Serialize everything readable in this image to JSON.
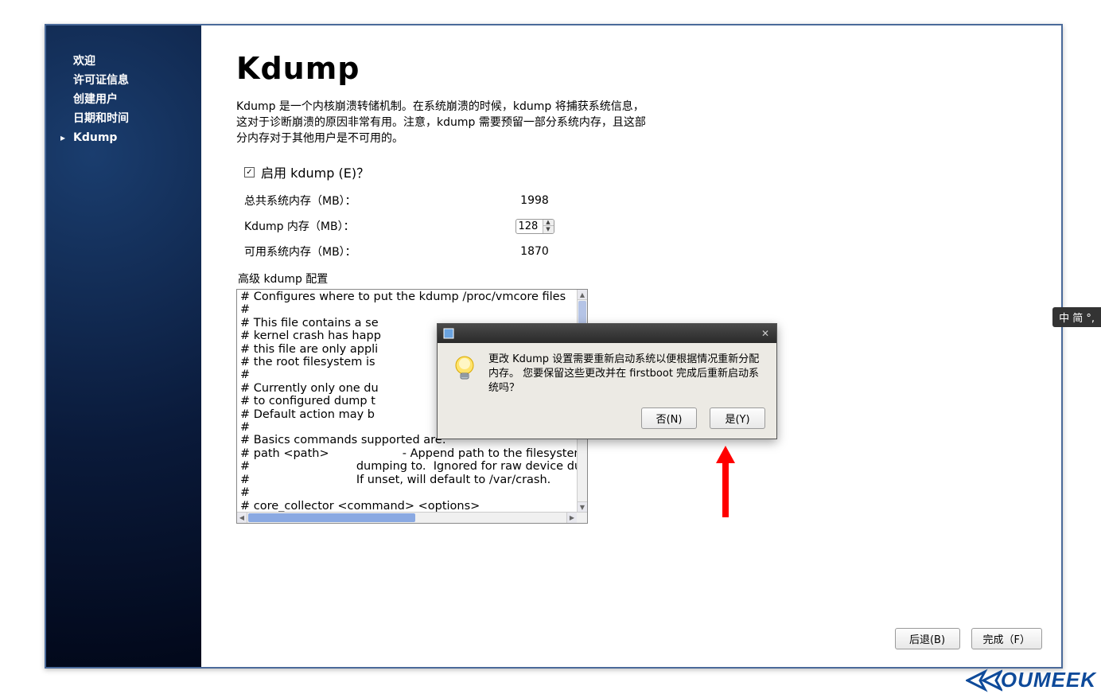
{
  "sidebar": {
    "items": [
      {
        "label": "欢迎"
      },
      {
        "label": "许可证信息"
      },
      {
        "label": "创建用户"
      },
      {
        "label": "日期和时间"
      },
      {
        "label": "Kdump"
      }
    ]
  },
  "page": {
    "title": "Kdump",
    "description": "Kdump 是一个内核崩溃转储机制。在系统崩溃的时候，kdump 将捕获系统信息，这对于诊断崩溃的原因非常有用。注意，kdump 需要预留一部分系统内存，且这部分内存对于其他用户是不可用的。",
    "enable_checkbox_label": "启用 kdump (E)？",
    "enable_checkbox_checked": "✓",
    "rows": {
      "total_label": "总共系统内存（MB）：",
      "total_value": "1998",
      "kdump_label": "Kdump 内存（MB）：",
      "kdump_value": "128",
      "avail_label": "可用系统内存（MB）：",
      "avail_value": "1870"
    },
    "advanced_label": "高级 kdump 配置",
    "config_text": "# Configures where to put the kdump /proc/vmcore files\n#\n# This file contains a se\n# kernel crash has happ\n# this file are only appli\n# the root filesystem is\n#\n# Currently only one du\n# to configured dump t\n# Default action may b\n#\n# Basics commands supported are:\n# path <path>                    - Append path to the filesystem device wh\n#                             dumping to.  Ignored for raw device dumps.\n#                             If unset, will default to /var/crash.\n#\n# core_collector <command> <options>"
  },
  "footer": {
    "back": "后退(B)",
    "finish": "完成（F）"
  },
  "dialog": {
    "message": "更改 Kdump 设置需要重新启动系统以便根据情况重新分配内存。 您要保留这些更改并在 firstboot 完成后重新启动系统吗？",
    "no": "否(N)",
    "yes": "是(Y)"
  },
  "ime": {
    "label": "中 简 °,"
  },
  "watermark": {
    "text": "OUMEEK"
  }
}
